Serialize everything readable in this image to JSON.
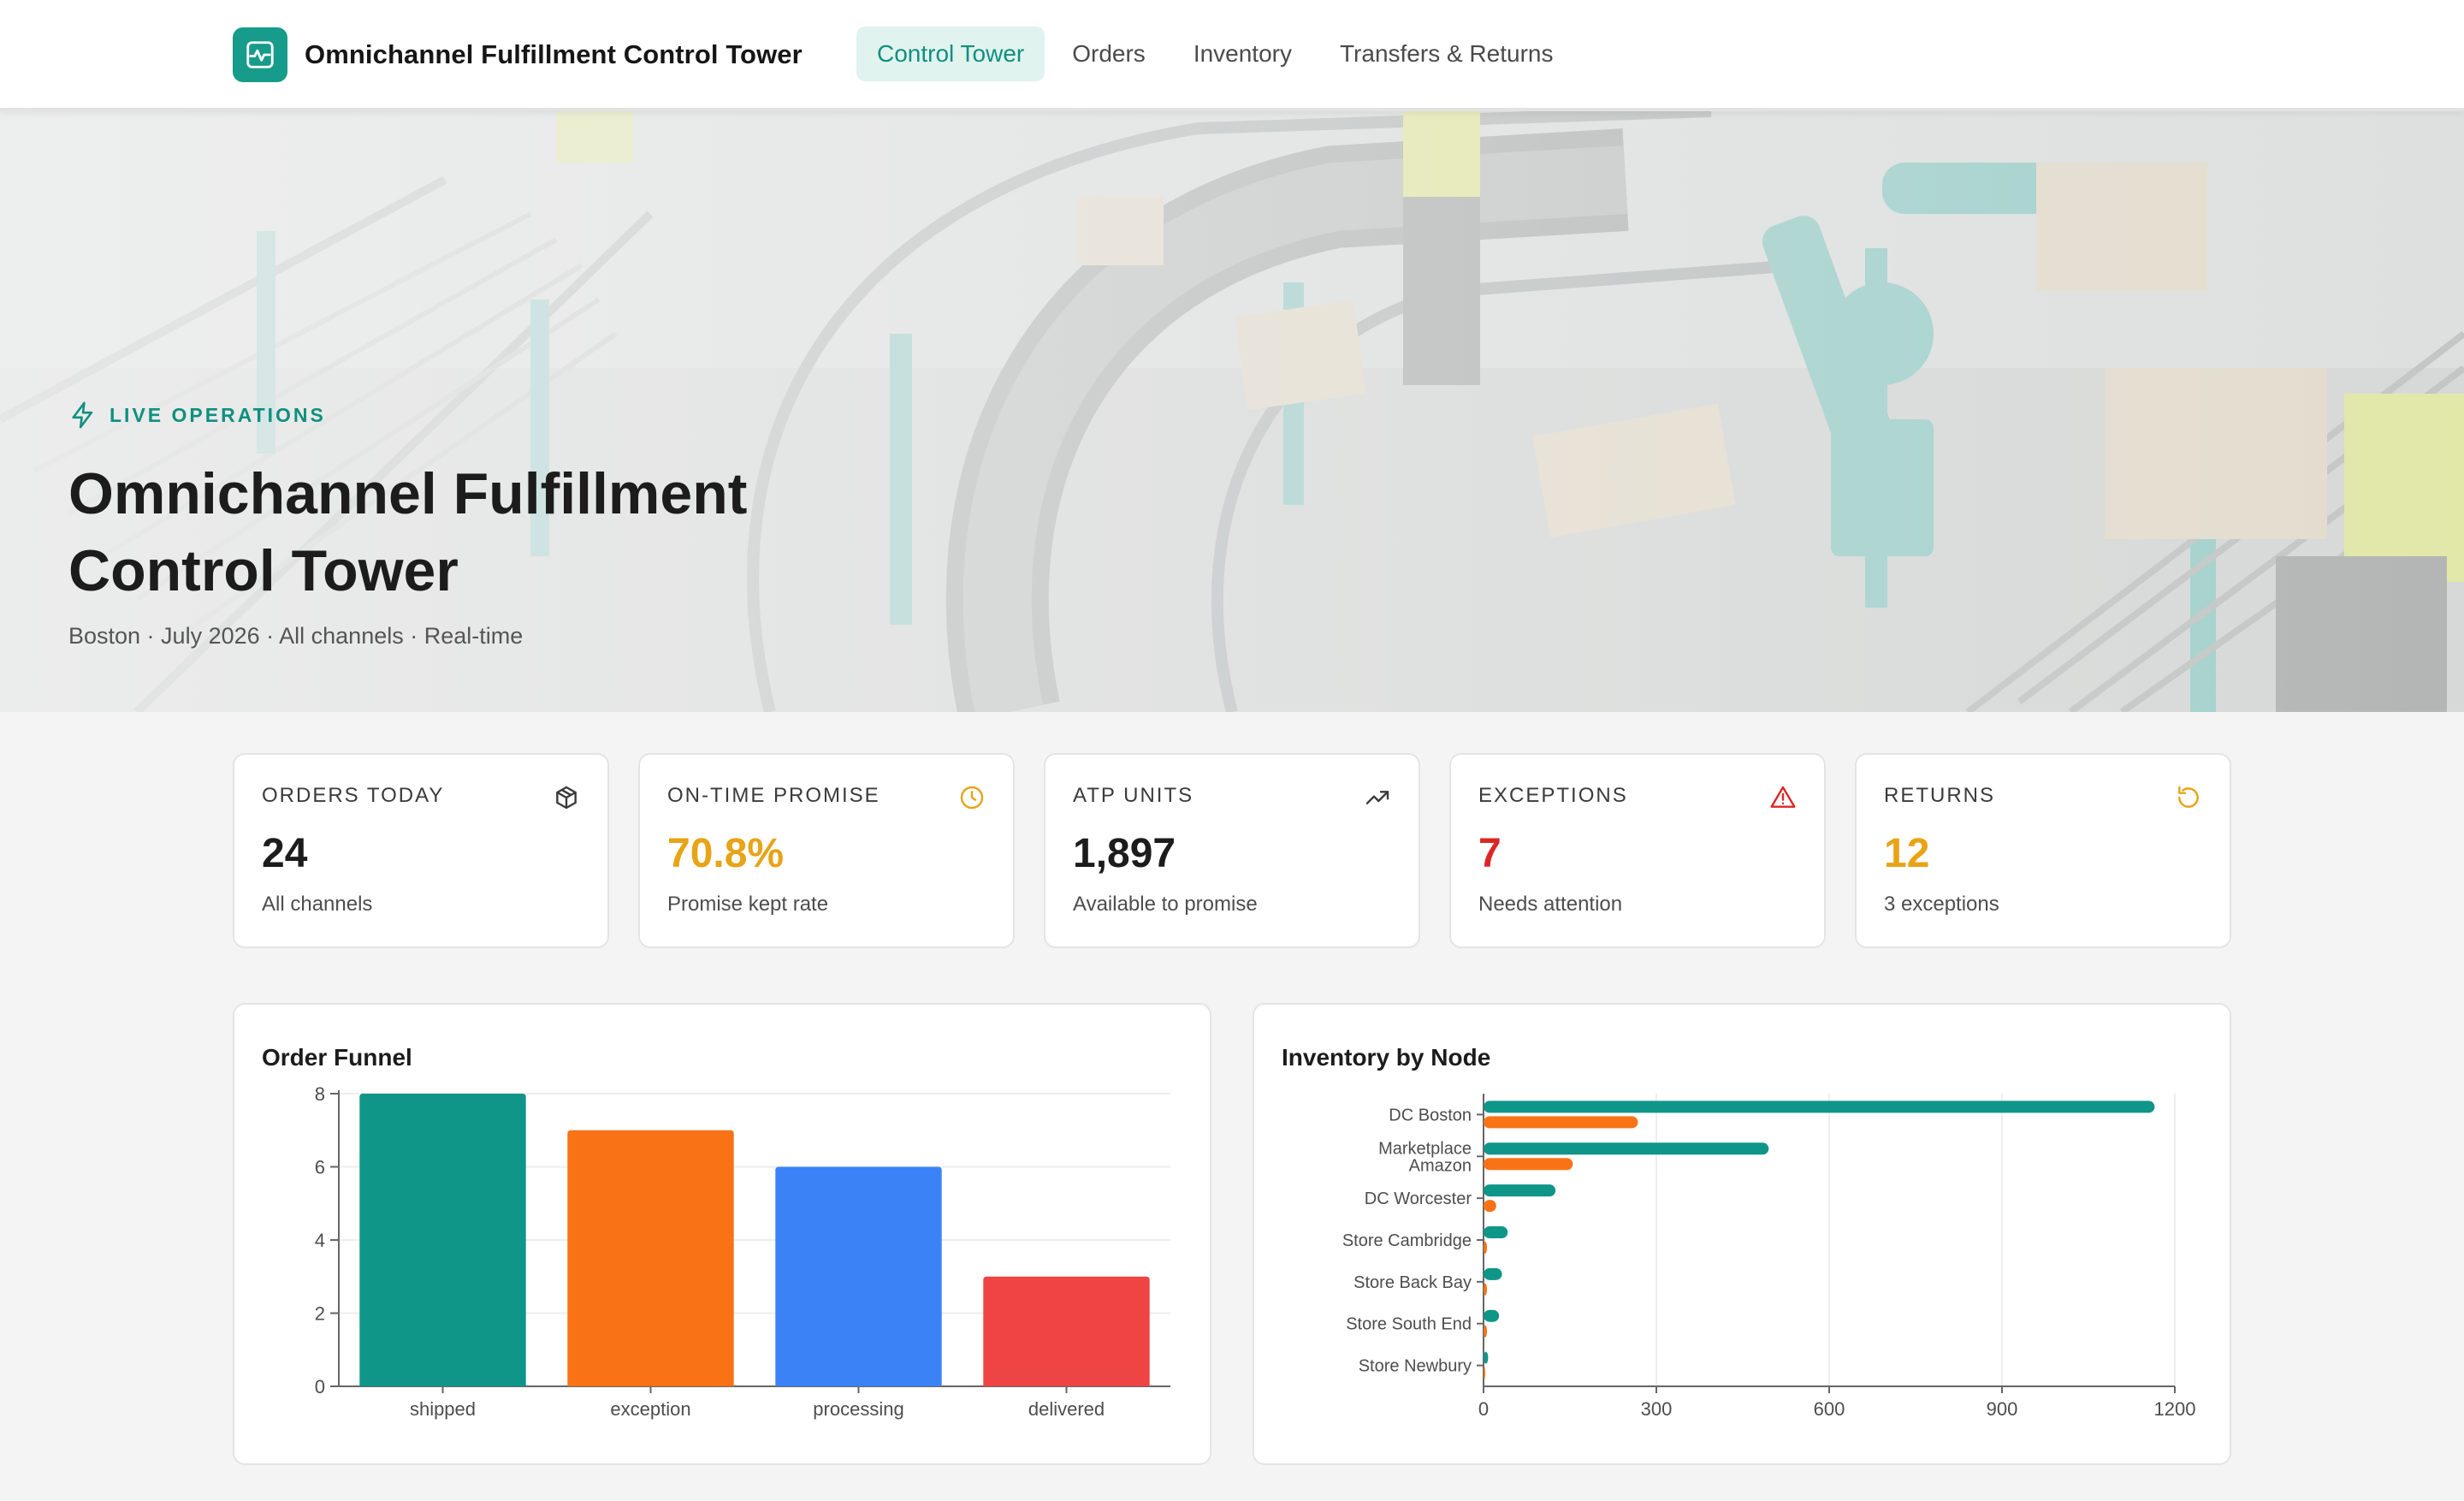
{
  "app": {
    "title": "Omnichannel Fulfillment Control Tower",
    "nav": [
      {
        "label": "Control Tower",
        "active": true
      },
      {
        "label": "Orders",
        "active": false
      },
      {
        "label": "Inventory",
        "active": false
      },
      {
        "label": "Transfers & Returns",
        "active": false
      }
    ]
  },
  "hero": {
    "tag": "LIVE OPERATIONS",
    "title_line1": "Omnichannel Fulfillment",
    "title_line2": "Control Tower",
    "subtitle": "Boston · July 2026 · All channels · Real-time",
    "image": "warehouse conveyor background photo",
    "tag_icon": "lightning-icon"
  },
  "kpis": [
    {
      "label": "ORDERS TODAY",
      "value": "24",
      "sub": "All channels",
      "icon": "package-icon",
      "color": "#1c1c1c",
      "icon_color": "#3a3a3a"
    },
    {
      "label": "ON-TIME PROMISE",
      "value": "70.8%",
      "sub": "Promise kept rate",
      "icon": "clock-icon",
      "color": "#e8a317",
      "icon_color": "#e8a317"
    },
    {
      "label": "ATP UNITS",
      "value": "1,897",
      "sub": "Available to promise",
      "icon": "trending-up-icon",
      "color": "#1c1c1c",
      "icon_color": "#3a3a3a"
    },
    {
      "label": "EXCEPTIONS",
      "value": "7",
      "sub": "Needs attention",
      "icon": "warning-icon",
      "color": "#dc2626",
      "icon_color": "#dc2626"
    },
    {
      "label": "RETURNS",
      "value": "12",
      "sub": "3 exceptions",
      "icon": "refresh-icon",
      "color": "#e8a317",
      "icon_color": "#e8a317"
    }
  ],
  "chart_data": [
    {
      "type": "bar",
      "title": "Order Funnel",
      "categories": [
        "shipped",
        "exception",
        "processing",
        "delivered"
      ],
      "values": [
        8,
        7,
        6,
        3
      ],
      "colors": [
        "#0f9688",
        "#f97316",
        "#3b82f6",
        "#ef4444"
      ],
      "yticks": [
        0,
        2,
        4,
        6,
        8
      ],
      "ylim": [
        0,
        8
      ],
      "grid": true
    },
    {
      "type": "bar",
      "orientation": "horizontal",
      "title": "Inventory by Node",
      "categories": [
        [
          "DC Boston"
        ],
        [
          "Marketplace",
          "Amazon"
        ],
        [
          "DC Worcester"
        ],
        [
          "Store Cambridge"
        ],
        [
          "Store Back Bay"
        ],
        [
          "Store South End"
        ],
        [
          "Store Newbury"
        ]
      ],
      "series": [
        {
          "values": [
            1165,
            495,
            125,
            42,
            32,
            27,
            8
          ],
          "color": "#0f9688"
        },
        {
          "values": [
            268,
            155,
            22,
            6,
            6,
            6,
            2
          ],
          "color": "#f97316"
        }
      ],
      "xticks": [
        0,
        300,
        600,
        900,
        1200
      ],
      "xlim": [
        0,
        1200
      ],
      "grid": true
    }
  ]
}
